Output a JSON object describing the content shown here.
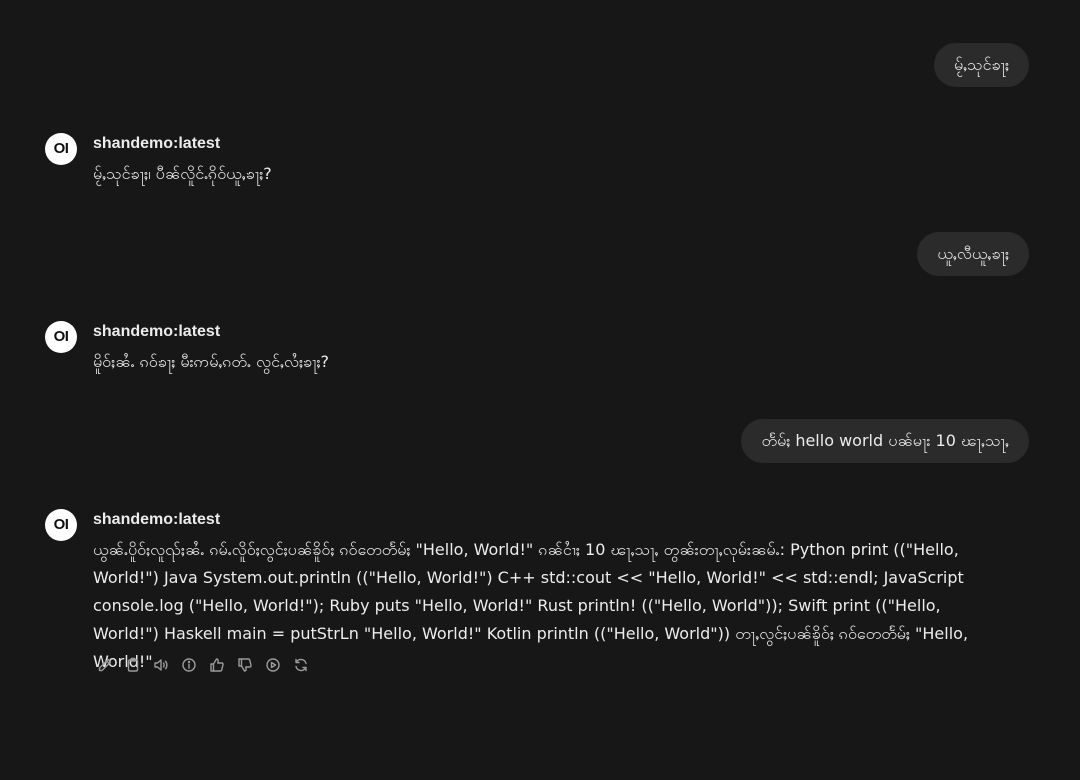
{
  "conversation": {
    "model_name": "shandemo:latest",
    "avatar_text": "OI",
    "messages": [
      {
        "role": "user",
        "text": "မႂ်ႇသုင်ၶႃႈ"
      },
      {
        "role": "assistant",
        "text": "မႂ်ႇသုင်ၶႃႈ၊ ပီၼ်လိူင်ႉၵိုဝ်ယူႇၶႃႈ?"
      },
      {
        "role": "user",
        "text": "ယူႇလီယူႇၶႃႈ"
      },
      {
        "role": "assistant",
        "text": "မိူဝ်ႈၼႆႉ ၵဝ်ၶႃႈ မီးဢမ်ႇၵတ်ႉ လွင်ႇလႆႈၶႃႈ?"
      },
      {
        "role": "user",
        "text": "တႅမ်ႈ hello world ပၼ်မႃး 10 ၽႃႇသႃႇ"
      },
      {
        "role": "assistant",
        "text": "ယွၼ်ႉပိူဝ်ႈလူၺ်ႈၼႆႉ ၵမ်ႉလိူဝ်ႈလွင်ႈပၼ်ၶိူဝ်ႈ ၵဝ်တေတႅမ်ႈ \"Hello, World!\" ၵၼ်ငၢႆႈ 10 ၽႃႇသႃႇ တွၼ်းတႃႇလုမ်းၼမ်ႉ: Python print ((\"Hello, World!\") Java System.out.println ((\"Hello, World!\") C++ std::cout << \"Hello, World!\" << std::endl; JavaScript console.log (\"Hello, World!\"); Ruby puts \"Hello, World!\" Rust println! ((\"Hello, World\")); Swift print ((\"Hello, World!\") Haskell main = putStrLn \"Hello, World!\" Kotlin println ((\"Hello, World\")) တႃႇလွင်ႈပၼ်ၶိူဝ်ႈ ၵဝ်တေတႅမ်ႈ \"Hello, World!\""
      }
    ]
  },
  "actions": [
    {
      "name": "edit-icon"
    },
    {
      "name": "copy-icon"
    },
    {
      "name": "read-aloud-icon"
    },
    {
      "name": "info-icon"
    },
    {
      "name": "thumbs-up-icon"
    },
    {
      "name": "thumbs-down-icon"
    },
    {
      "name": "continue-icon"
    },
    {
      "name": "regenerate-icon"
    }
  ],
  "colors": {
    "background": "#171717",
    "user_bubble": "#2b2b2b",
    "text": "#ececec",
    "icon": "#9b9b9b"
  }
}
